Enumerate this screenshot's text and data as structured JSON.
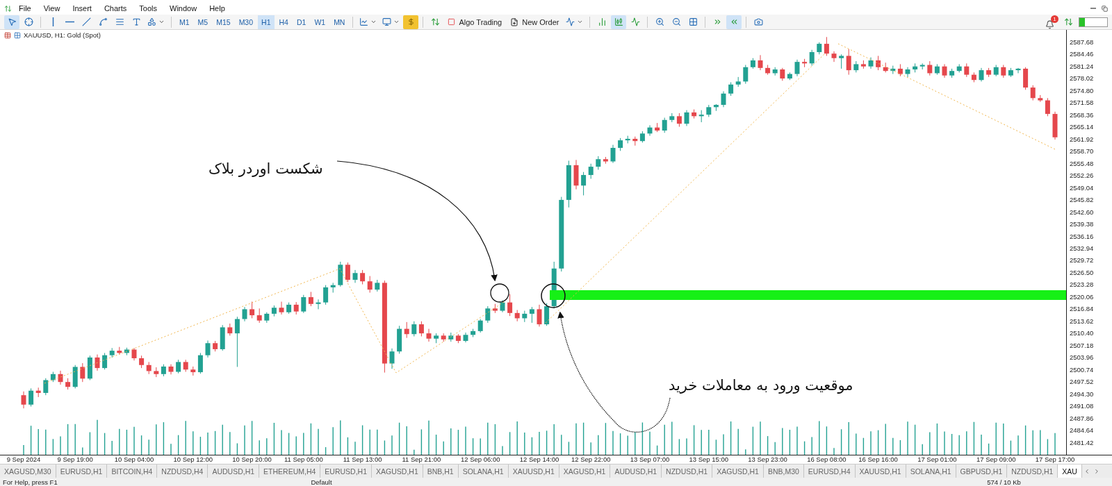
{
  "menu": [
    "File",
    "View",
    "Insert",
    "Charts",
    "Tools",
    "Window",
    "Help"
  ],
  "timeframes": [
    {
      "label": "M1",
      "selected": false
    },
    {
      "label": "M5",
      "selected": false
    },
    {
      "label": "M15",
      "selected": false
    },
    {
      "label": "M30",
      "selected": false
    },
    {
      "label": "H1",
      "selected": true
    },
    {
      "label": "H4",
      "selected": false
    },
    {
      "label": "D1",
      "selected": false
    },
    {
      "label": "W1",
      "selected": false
    },
    {
      "label": "MN",
      "selected": false
    }
  ],
  "buttons": [
    {
      "kind": "algo",
      "label": "Algo Trading"
    },
    {
      "kind": "order",
      "label": "New Order"
    }
  ],
  "chart_types": [
    {
      "kind": "bars",
      "selected": false
    },
    {
      "kind": "candles",
      "selected": true
    },
    {
      "kind": "line",
      "selected": false
    }
  ],
  "scroll_toggles": [
    {
      "kind": "shift",
      "selected": false
    },
    {
      "kind": "autoscroll",
      "selected": true
    }
  ],
  "notifications": {
    "count": "1"
  },
  "chart": {
    "title": "XAUUSD, H1: Gold (Spot)",
    "annotations": [
      {
        "kind": "breakout",
        "text": "شکست اوردر بلاک"
      },
      {
        "kind": "entry",
        "text": "موقعیت ورود به معاملات خرید"
      }
    ],
    "chart_data": {
      "type": "candlestick",
      "categories": [
        "9 Sep 2024",
        null,
        null,
        null,
        null,
        null,
        null,
        "9 Sep 19:00",
        null,
        null,
        null,
        null,
        null,
        null,
        null,
        "10 Sep 04:00",
        null,
        null,
        null,
        null,
        null,
        null,
        null,
        "10 Sep 12:00",
        null,
        null,
        null,
        null,
        null,
        null,
        null,
        "10 Sep 20:00",
        null,
        null,
        null,
        null,
        null,
        null,
        "11 Sep 05:00",
        null,
        null,
        null,
        null,
        null,
        null,
        null,
        "11 Sep 13:00",
        null,
        null,
        null,
        null,
        null,
        null,
        null,
        "11 Sep 21:00",
        null,
        null,
        null,
        null,
        null,
        null,
        null,
        "12 Sep 06:00",
        null,
        null,
        null,
        null,
        null,
        null,
        null,
        "12 Sep 14:00",
        null,
        null,
        null,
        null,
        null,
        null,
        "12 Sep 22:00",
        null,
        null,
        null,
        null,
        null,
        null,
        null,
        "13 Sep 07:00",
        null,
        null,
        null,
        null,
        null,
        null,
        null,
        "13 Sep 15:00",
        null,
        null,
        null,
        null,
        null,
        null,
        null,
        "13 Sep 23:00",
        null,
        null,
        null,
        null,
        null,
        null,
        null,
        "16 Sep 08:00",
        null,
        null,
        null,
        null,
        null,
        null,
        "16 Sep 16:00",
        null,
        null,
        null,
        null,
        null,
        null,
        null,
        "17 Sep 01:00",
        null,
        null,
        null,
        null,
        null,
        null,
        null,
        "17 Sep 09:00",
        null,
        null,
        null,
        null,
        null,
        null,
        null,
        "17 Sep 17:00"
      ],
      "ylim": [
        2478.2,
        2590.9
      ],
      "yticks": [
        {
          "value": 2587.68,
          "label": "2587.68"
        },
        {
          "value": 2584.46,
          "label": "2584.46"
        },
        {
          "value": 2581.24,
          "label": "2581.24"
        },
        {
          "value": 2578.02,
          "label": "2578.02"
        },
        {
          "value": 2574.8,
          "label": "2574.80"
        },
        {
          "value": 2571.58,
          "label": "2571.58"
        },
        {
          "value": 2568.36,
          "label": "2568.36"
        },
        {
          "value": 2565.14,
          "label": "2565.14"
        },
        {
          "value": 2561.92,
          "label": "2561.92"
        },
        {
          "value": 2558.7,
          "label": "2558.70"
        },
        {
          "value": 2555.48,
          "label": "2555.48"
        },
        {
          "value": 2552.26,
          "label": "2552.26"
        },
        {
          "value": 2549.04,
          "label": "2549.04"
        },
        {
          "value": 2545.82,
          "label": "2545.82"
        },
        {
          "value": 2542.6,
          "label": "2542.60"
        },
        {
          "value": 2539.38,
          "label": "2539.38"
        },
        {
          "value": 2536.16,
          "label": "2536.16"
        },
        {
          "value": 2532.94,
          "label": "2532.94"
        },
        {
          "value": 2529.72,
          "label": "2529.72"
        },
        {
          "value": 2526.5,
          "label": "2526.50"
        },
        {
          "value": 2523.28,
          "label": "2523.28"
        },
        {
          "value": 2520.06,
          "label": "2520.06"
        },
        {
          "value": 2516.84,
          "label": "2516.84"
        },
        {
          "value": 2513.62,
          "label": "2513.62"
        },
        {
          "value": 2510.4,
          "label": "2510.40"
        },
        {
          "value": 2507.18,
          "label": "2507.18"
        },
        {
          "value": 2503.96,
          "label": "2503.96"
        },
        {
          "value": 2500.74,
          "label": "2500.74"
        },
        {
          "value": 2497.52,
          "label": "2497.52"
        },
        {
          "value": 2494.3,
          "label": "2494.30"
        },
        {
          "value": 2491.08,
          "label": "2491.08"
        },
        {
          "value": 2487.86,
          "label": "2487.86"
        },
        {
          "value": 2484.64,
          "label": "2484.64"
        },
        {
          "value": 2481.42,
          "label": "2481.42"
        }
      ],
      "ohlc": [
        [
          2494,
          2495,
          2490.5,
          2491.5
        ],
        [
          2491.5,
          2495.8,
          2491,
          2495.2
        ],
        [
          2495.2,
          2496,
          2493.5,
          2494.6
        ],
        [
          2494.6,
          2498.5,
          2494,
          2498
        ],
        [
          2498,
          2500.2,
          2497.5,
          2499.6
        ],
        [
          2499.6,
          2500.5,
          2496.8,
          2497.5
        ],
        [
          2497.5,
          2498.5,
          2495.5,
          2496.2
        ],
        [
          2496.2,
          2502,
          2495.8,
          2501.5
        ],
        [
          2501.5,
          2502.5,
          2497.5,
          2498.4
        ],
        [
          2498.4,
          2504.5,
          2498,
          2504
        ],
        [
          2504,
          2504.8,
          2500.5,
          2501.2
        ],
        [
          2501.2,
          2505.2,
          2500.8,
          2504.6
        ],
        [
          2504.6,
          2506.5,
          2504,
          2505.8
        ],
        [
          2505.8,
          2506.8,
          2504.8,
          2505.2
        ],
        [
          2505.2,
          2506.6,
          2504.6,
          2506.1
        ],
        [
          2506.1,
          2506.5,
          2503.2,
          2503.8
        ],
        [
          2503.8,
          2504.5,
          2501.2,
          2502
        ],
        [
          2502,
          2502.8,
          2499.6,
          2500.4
        ],
        [
          2500.4,
          2501.4,
          2498.8,
          2499.6
        ],
        [
          2499.6,
          2502.2,
          2499,
          2501.6
        ],
        [
          2501.6,
          2502.2,
          2499.5,
          2500.2
        ],
        [
          2500.2,
          2503.4,
          2499.8,
          2502.8
        ],
        [
          2502.8,
          2503.4,
          2500.2,
          2500.8
        ],
        [
          2500.8,
          2501.6,
          2499.2,
          2500.1
        ],
        [
          2500.1,
          2505.2,
          2499.7,
          2504.6
        ],
        [
          2504.6,
          2508.5,
          2504,
          2507.8
        ],
        [
          2507.8,
          2508.4,
          2505.6,
          2506.2
        ],
        [
          2506.2,
          2512.6,
          2505.8,
          2512
        ],
        [
          2512,
          2513,
          2509.8,
          2510.4
        ],
        [
          2510.4,
          2514.8,
          2501.5,
          2514.2
        ],
        [
          2514.2,
          2517.4,
          2513.6,
          2516.8
        ],
        [
          2516.8,
          2518.8,
          2514.4,
          2515.2
        ],
        [
          2515.2,
          2517,
          2513.2,
          2513.8
        ],
        [
          2513.8,
          2516,
          2513.2,
          2515.6
        ],
        [
          2515.6,
          2517.8,
          2514.9,
          2517.2
        ],
        [
          2517.2,
          2518.8,
          2515.4,
          2516
        ],
        [
          2516,
          2518.6,
          2515.6,
          2518
        ],
        [
          2518,
          2518.7,
          2515.4,
          2516.2
        ],
        [
          2516.2,
          2520.6,
          2515.8,
          2520
        ],
        [
          2520,
          2521.4,
          2517.6,
          2518.2
        ],
        [
          2518.2,
          2519.4,
          2516.8,
          2518.6
        ],
        [
          2518.6,
          2523.2,
          2518,
          2522.6
        ],
        [
          2522.6,
          2523.8,
          2521.2,
          2523.2
        ],
        [
          2523.2,
          2529.4,
          2522.8,
          2528.6
        ],
        [
          2528.6,
          2529.2,
          2524,
          2524.6
        ],
        [
          2524.6,
          2527.2,
          2523.8,
          2526.4
        ],
        [
          2526.4,
          2527.2,
          2523.4,
          2524.2
        ],
        [
          2524.2,
          2525.6,
          2521.2,
          2522
        ],
        [
          2522,
          2524.6,
          2521.5,
          2523.8
        ],
        [
          2523.8,
          2524.4,
          2500,
          2502.4
        ],
        [
          2502.4,
          2506.4,
          2501,
          2505.6
        ],
        [
          2505.6,
          2512.4,
          2505,
          2511.6
        ],
        [
          2511.6,
          2513.4,
          2509.2,
          2510.2
        ],
        [
          2510.2,
          2513.6,
          2509.6,
          2512.8
        ],
        [
          2512.8,
          2513.6,
          2509.6,
          2510.4
        ],
        [
          2510.4,
          2511.6,
          2508.2,
          2509
        ],
        [
          2509,
          2510.4,
          2507.8,
          2509.8
        ],
        [
          2509.8,
          2510.4,
          2508.2,
          2508.8
        ],
        [
          2508.8,
          2510.6,
          2508.2,
          2509.8
        ],
        [
          2509.8,
          2510.2,
          2507.8,
          2508.4
        ],
        [
          2508.4,
          2510.6,
          2508,
          2510
        ],
        [
          2510,
          2511.6,
          2509.4,
          2511
        ],
        [
          2511,
          2514.2,
          2510.6,
          2513.8
        ],
        [
          2513.8,
          2517.6,
          2513.2,
          2517
        ],
        [
          2517,
          2518.2,
          2515.8,
          2516.4
        ],
        [
          2516.4,
          2519.2,
          2516,
          2518.6
        ],
        [
          2518.6,
          2520.8,
          2515,
          2515.8
        ],
        [
          2515.8,
          2516.6,
          2513.6,
          2514.4
        ],
        [
          2514.4,
          2516.4,
          2513.4,
          2515.6
        ],
        [
          2515.6,
          2517.4,
          2513.2,
          2516.8
        ],
        [
          2516.8,
          2518,
          2512.2,
          2512.8
        ],
        [
          2512.8,
          2518.4,
          2512.4,
          2517.6
        ],
        [
          2517.6,
          2529.4,
          2517,
          2527.6
        ],
        [
          2527.6,
          2546.6,
          2526.8,
          2545.8
        ],
        [
          2545.8,
          2556.2,
          2543.8,
          2555
        ],
        [
          2555,
          2556.4,
          2548.6,
          2549.6
        ],
        [
          2549.6,
          2553.2,
          2547,
          2552.4
        ],
        [
          2552.4,
          2555.4,
          2551.4,
          2554.6
        ],
        [
          2554.6,
          2557.4,
          2553.8,
          2556.6
        ],
        [
          2556.6,
          2557.2,
          2555.4,
          2556
        ],
        [
          2556,
          2560.4,
          2555.6,
          2559.6
        ],
        [
          2559.6,
          2562.2,
          2558.8,
          2561.6
        ],
        [
          2561.6,
          2562.8,
          2560.8,
          2562
        ],
        [
          2562,
          2562.6,
          2560.2,
          2561.4
        ],
        [
          2561.4,
          2564,
          2561,
          2563.4
        ],
        [
          2563.4,
          2565.6,
          2562.8,
          2565
        ],
        [
          2565,
          2566.2,
          2563.8,
          2564.2
        ],
        [
          2564.2,
          2567.6,
          2563.6,
          2567
        ],
        [
          2567,
          2568.8,
          2566.4,
          2568
        ],
        [
          2568,
          2568.8,
          2565.2,
          2566
        ],
        [
          2566,
          2569.6,
          2565.4,
          2569
        ],
        [
          2569,
          2569.8,
          2567.4,
          2568
        ],
        [
          2568,
          2569.6,
          2566.4,
          2568.4
        ],
        [
          2568.4,
          2571,
          2567.8,
          2570.4
        ],
        [
          2570.4,
          2571.2,
          2569.4,
          2571
        ],
        [
          2571,
          2574.6,
          2570.4,
          2574
        ],
        [
          2574,
          2577,
          2573.4,
          2576.4
        ],
        [
          2576.4,
          2578.4,
          2575.8,
          2577.2
        ],
        [
          2577.2,
          2581.6,
          2576.6,
          2581
        ],
        [
          2581,
          2583.4,
          2580.6,
          2582.8
        ],
        [
          2582.8,
          2584.2,
          2580.2,
          2580.8
        ],
        [
          2580.8,
          2581.6,
          2579,
          2579.4
        ],
        [
          2579.4,
          2581,
          2578.8,
          2580.4
        ],
        [
          2580.4,
          2580.8,
          2577.4,
          2578
        ],
        [
          2578,
          2579.6,
          2577.6,
          2579.2
        ],
        [
          2579.2,
          2583,
          2578.6,
          2582.4
        ],
        [
          2582.4,
          2583.2,
          2581,
          2582
        ],
        [
          2582,
          2585.6,
          2581.4,
          2585
        ],
        [
          2585,
          2587.6,
          2584.4,
          2587.2
        ],
        [
          2587.2,
          2589,
          2584,
          2584.6
        ],
        [
          2584.6,
          2585.2,
          2582.4,
          2583.4
        ],
        [
          2583.4,
          2584.4,
          2580.6,
          2584
        ],
        [
          2584,
          2585.8,
          2579,
          2580.2
        ],
        [
          2580.2,
          2582.6,
          2579.6,
          2581.8
        ],
        [
          2581.8,
          2582.8,
          2580.6,
          2581.2
        ],
        [
          2581.2,
          2583.6,
          2580.6,
          2582.8
        ],
        [
          2582.8,
          2584,
          2580.2,
          2581
        ],
        [
          2581,
          2582.2,
          2579.6,
          2580
        ],
        [
          2580,
          2581.4,
          2579.2,
          2580.6
        ],
        [
          2580.6,
          2581.8,
          2578.6,
          2579.2
        ],
        [
          2579.2,
          2581,
          2578.4,
          2580.4
        ],
        [
          2580.4,
          2582,
          2579.6,
          2581.2
        ],
        [
          2581.2,
          2582,
          2580.4,
          2581.6
        ],
        [
          2581.6,
          2582.6,
          2578.8,
          2579.4
        ],
        [
          2579.4,
          2581.8,
          2579,
          2581.2
        ],
        [
          2581.2,
          2581.8,
          2578.2,
          2578.8
        ],
        [
          2578.8,
          2580.6,
          2578.2,
          2580
        ],
        [
          2580,
          2581.8,
          2579.6,
          2581.2
        ],
        [
          2581.2,
          2582,
          2578.4,
          2579
        ],
        [
          2579,
          2579.6,
          2577,
          2577.6
        ],
        [
          2577.6,
          2580.8,
          2577.2,
          2580.2
        ],
        [
          2580.2,
          2580.8,
          2578.4,
          2579
        ],
        [
          2579,
          2581.6,
          2578.6,
          2581
        ],
        [
          2581,
          2581.6,
          2578.2,
          2578.8
        ],
        [
          2578.8,
          2580.8,
          2578.4,
          2580.2
        ],
        [
          2580.2,
          2580.8,
          2579.4,
          2580.6
        ],
        [
          2580.6,
          2581,
          2575,
          2575.6
        ],
        [
          2575.6,
          2576.2,
          2572.2,
          2572.8
        ],
        [
          2572.8,
          2573.6,
          2571.8,
          2572.2
        ],
        [
          2572.2,
          2572.8,
          2568,
          2568.6
        ],
        [
          2568.6,
          2569.2,
          2561.8,
          2562.4
        ]
      ]
    }
  },
  "tabs": [
    {
      "label": "XAGUSD,M30",
      "selected": false
    },
    {
      "label": "EURUSD,H1",
      "selected": false
    },
    {
      "label": "BITCOIN,H4",
      "selected": false
    },
    {
      "label": "NZDUSD,H4",
      "selected": false
    },
    {
      "label": "AUDUSD,H1",
      "selected": false
    },
    {
      "label": "ETHEREUM,H4",
      "selected": false
    },
    {
      "label": "EURUSD,H1",
      "selected": false
    },
    {
      "label": "XAGUSD,H1",
      "selected": false
    },
    {
      "label": "BNB,H1",
      "selected": false
    },
    {
      "label": "SOLANA,H1",
      "selected": false
    },
    {
      "label": "XAUUSD,H1",
      "selected": false
    },
    {
      "label": "XAGUSD,H1",
      "selected": false
    },
    {
      "label": "AUDUSD,H1",
      "selected": false
    },
    {
      "label": "NZDUSD,H1",
      "selected": false
    },
    {
      "label": "XAGUSD,H1",
      "selected": false
    },
    {
      "label": "BNB,M30",
      "selected": false
    },
    {
      "label": "EURUSD,H4",
      "selected": false
    },
    {
      "label": "XAUUSD,H1",
      "selected": false
    },
    {
      "label": "SOLANA,H1",
      "selected": false
    },
    {
      "label": "GBPUSD,H1",
      "selected": false
    },
    {
      "label": "NZDUSD,H1",
      "selected": false
    },
    {
      "label": "XAU",
      "selected": true
    }
  ],
  "status_bar": [
    "For Help, press F1",
    "Default",
    "574 / 10 Kb"
  ]
}
